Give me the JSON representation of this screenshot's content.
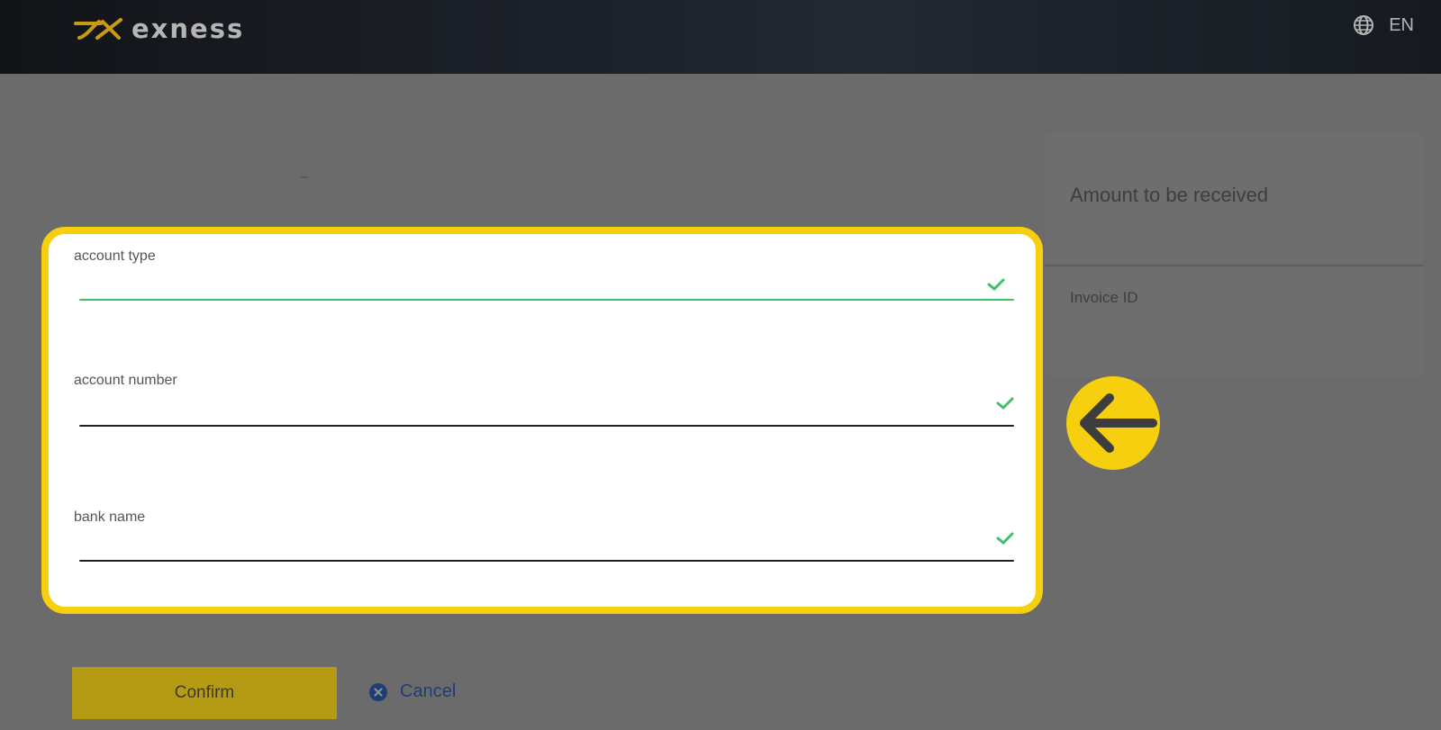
{
  "header": {
    "logo_text": "exness",
    "logo_icon": "exness-logo-icon",
    "language": "EN",
    "language_icon": "globe-icon"
  },
  "summary": {
    "amount_label": "Amount to be received",
    "invoice_label": "Invoice ID"
  },
  "form": {
    "fields": [
      {
        "label": "account type",
        "status_icon": "check-icon"
      },
      {
        "label": "account number",
        "status_icon": "check-icon"
      },
      {
        "label": "bank name",
        "status_icon": "check-icon"
      }
    ],
    "highlight_color": "#f6cf0e",
    "valid_color": "#3fbf6a"
  },
  "callout": {
    "icon": "arrow-left-icon",
    "color": "#f6cf0e"
  },
  "actions": {
    "confirm_label": "Confirm",
    "cancel_label": "Cancel",
    "cancel_icon": "close-circle-icon"
  }
}
